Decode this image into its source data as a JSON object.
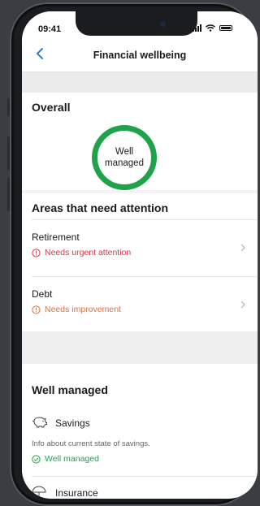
{
  "status_bar": {
    "time": "09:41"
  },
  "nav": {
    "title": "Financial wellbeing"
  },
  "overall": {
    "heading": "Overall",
    "ring_line1": "Well",
    "ring_line2": "managed",
    "ring_color": "#1fa34a"
  },
  "attention": {
    "heading": "Areas that need attention",
    "items": [
      {
        "title": "Retirement",
        "status": "Needs urgent attention",
        "color": "#d7364a"
      },
      {
        "title": "Debt",
        "status": "Needs improvement",
        "color": "#e0703a"
      }
    ]
  },
  "well_managed": {
    "heading": "Well managed",
    "items": [
      {
        "title": "Savings",
        "info": "Info about current state of savings.",
        "status": "Well managed",
        "color": "#1fa34a"
      },
      {
        "title": "Insurance"
      }
    ]
  }
}
